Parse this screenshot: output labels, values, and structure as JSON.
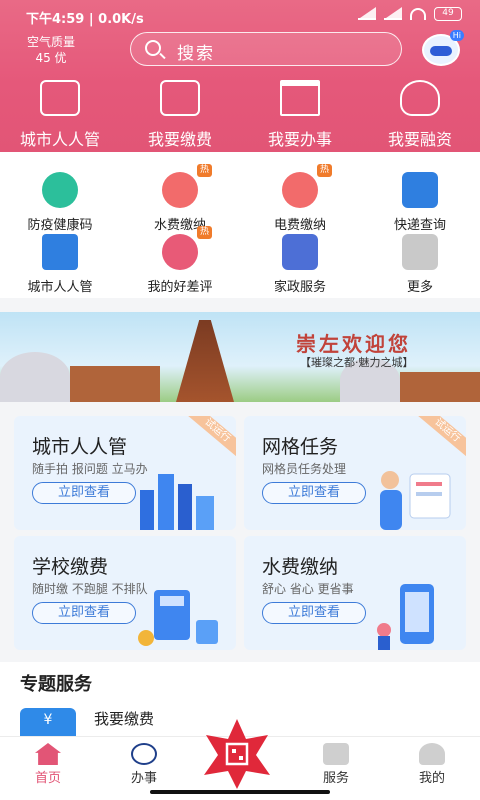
{
  "status": {
    "time": "下午4:59",
    "speed": "0.0K/s",
    "battery": "49"
  },
  "header": {
    "air_label": "空气质量",
    "air_value": "45 优",
    "search_placeholder": "搜索",
    "robot_badge": "Hi",
    "nav": [
      {
        "label": "城市人人管",
        "icon": "city-management-icon"
      },
      {
        "label": "我要缴费",
        "icon": "payment-wallet-icon"
      },
      {
        "label": "我要办事",
        "icon": "government-building-icon"
      },
      {
        "label": "我要融资",
        "icon": "hands-heart-icon"
      }
    ]
  },
  "services": [
    {
      "label": "防疫健康码",
      "icon": "qr-code-icon",
      "color": "#2cbf9b",
      "hot": ""
    },
    {
      "label": "水费缴纳",
      "icon": "water-drop-icon",
      "color": "#f26b6b",
      "hot": "热"
    },
    {
      "label": "电费缴纳",
      "icon": "lightning-icon",
      "color": "#f26b6b",
      "hot": "热"
    },
    {
      "label": "快递查询",
      "icon": "delivery-truck-icon",
      "color": "#2f7fe0",
      "hot": ""
    },
    {
      "label": "城市人人管",
      "icon": "city-grid-icon",
      "color": "#2f7fe0",
      "hot": ""
    },
    {
      "label": "我的好差评",
      "icon": "rating-medal-icon",
      "color": "#e85a77",
      "hot": "热"
    },
    {
      "label": "家政服务",
      "icon": "house-service-icon",
      "color": "#4d6fd6",
      "hot": ""
    },
    {
      "label": "更多",
      "icon": "more-grid-icon",
      "color": "#a6a6a6",
      "hot": ""
    }
  ],
  "banner": {
    "title": "崇左欢迎您",
    "subtitle": "【璀璨之都·魅力之城】"
  },
  "cards": [
    {
      "title": "城市人人管",
      "subtitle": "随手拍 报问题 立马办",
      "button": "立即查看",
      "tag": "试运行"
    },
    {
      "title": "网格任务",
      "subtitle": "网格员任务处理",
      "button": "立即查看",
      "tag": "试运行"
    },
    {
      "title": "学校缴费",
      "subtitle": "随时缴 不跑腿 不排队",
      "button": "立即查看",
      "tag": ""
    },
    {
      "title": "水费缴纳",
      "subtitle": "舒心 省心 更省事",
      "button": "立即查看",
      "tag": ""
    }
  ],
  "section": {
    "title": "专题服务",
    "first_item": "我要缴费",
    "first_item_icon_text": "¥"
  },
  "tabbar": [
    {
      "label": "首页",
      "active": true
    },
    {
      "label": "办事",
      "active": false
    },
    {
      "label": "",
      "active": false
    },
    {
      "label": "服务",
      "active": false
    },
    {
      "label": "我的",
      "active": false
    }
  ],
  "colors": {
    "header": "#e5587a",
    "accent_blue": "#3d7bd8",
    "active_tab": "#e25576"
  }
}
